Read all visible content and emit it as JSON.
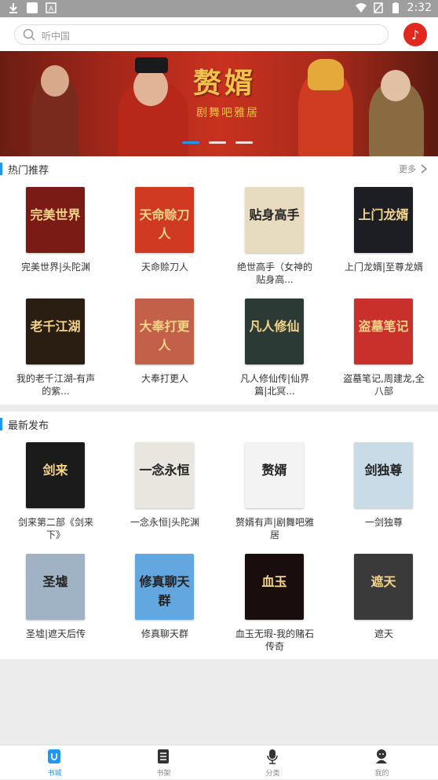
{
  "statusbar": {
    "time": "2:32"
  },
  "search": {
    "placeholder": "听中国"
  },
  "banner": {
    "title": "赘婿",
    "subtitle": "剧舞吧雅居"
  },
  "hot": {
    "title": "热门推荐",
    "more": "更多",
    "books": [
      {
        "title": "完美世界|头陀渊",
        "cover_text": "完美世界",
        "cover_bg": "#7a1b16"
      },
      {
        "title": "天命赊刀人",
        "cover_text": "天命赊刀人",
        "cover_bg": "#d13a22"
      },
      {
        "title": "绝世高手（女神的贴身高...",
        "cover_text": "贴身高手",
        "cover_bg": "#e8dcc0"
      },
      {
        "title": "上门龙婿|至尊龙婿",
        "cover_text": "上门龙婿",
        "cover_bg": "#1d1d24"
      },
      {
        "title": "我的老千江湖-有声的紫...",
        "cover_text": "老千江湖",
        "cover_bg": "#2a1d12"
      },
      {
        "title": "大奉打更人",
        "cover_text": "大奉打更人",
        "cover_bg": "#c2604a"
      },
      {
        "title": "凡人修仙传|仙界篇|北冥...",
        "cover_text": "凡人修仙",
        "cover_bg": "#2c3a36"
      },
      {
        "title": "盗墓笔记,周建龙,全八部",
        "cover_text": "盗墓笔记",
        "cover_bg": "#c9302c"
      }
    ]
  },
  "latest": {
    "title": "最新发布",
    "books": [
      {
        "title": "剑来第二部《剑来下》",
        "cover_text": "剑来",
        "cover_bg": "#1b1b1b"
      },
      {
        "title": "一念永恒|头陀渊",
        "cover_text": "一念永恒",
        "cover_bg": "#e9e6e0"
      },
      {
        "title": "赘婿有声|剧舞吧雅居",
        "cover_text": "赘婿",
        "cover_bg": "#f3f3f3"
      },
      {
        "title": "一剑独尊",
        "cover_text": "剑独尊",
        "cover_bg": "#c8dbe6"
      },
      {
        "title": "圣墟|遮天后传",
        "cover_text": "圣墟",
        "cover_bg": "#9fb3c4"
      },
      {
        "title": "修真聊天群",
        "cover_text": "修真聊天群",
        "cover_bg": "#62a7e0"
      },
      {
        "title": "血玉无瑕-我的赌石传奇",
        "cover_text": "血玉",
        "cover_bg": "#1a0d0d"
      },
      {
        "title": "遮天",
        "cover_text": "遮天",
        "cover_bg": "#3a3a3a"
      }
    ]
  },
  "tabs": [
    {
      "label": "书城",
      "icon": "bookstore-icon",
      "active": true
    },
    {
      "label": "书架",
      "icon": "bookshelf-icon",
      "active": false
    },
    {
      "label": "分类",
      "icon": "microphone-icon",
      "active": false
    },
    {
      "label": "我的",
      "icon": "profile-icon",
      "active": false
    }
  ],
  "colors": {
    "accent": "#2196f3",
    "music": "#e0281f"
  }
}
